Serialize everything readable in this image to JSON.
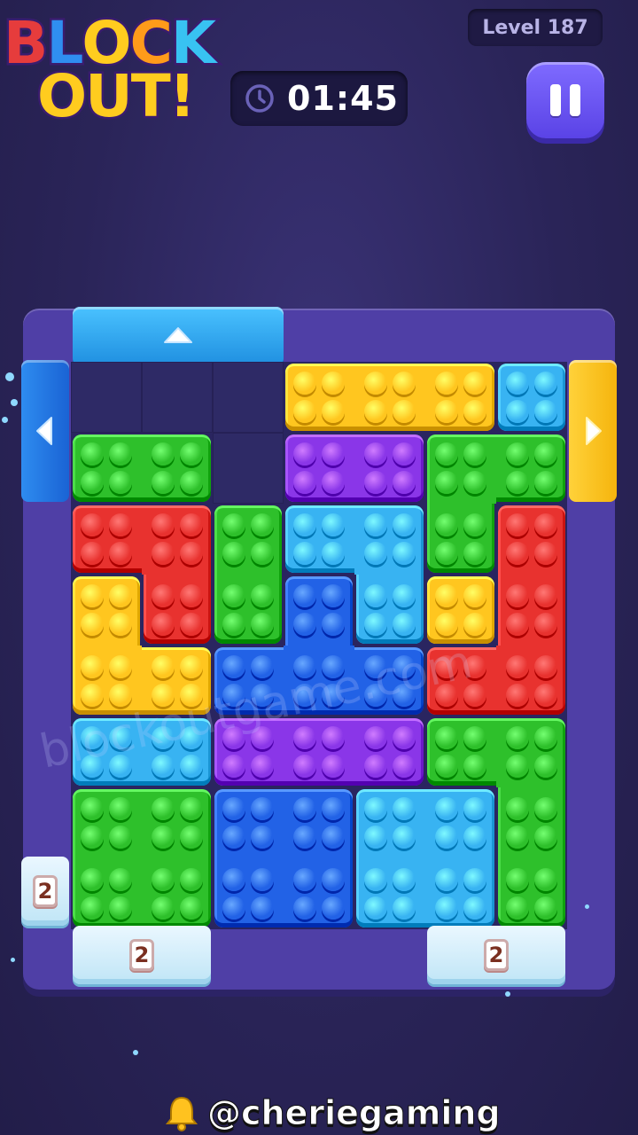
{
  "logo": {
    "line1": "BLOCK",
    "line2": "OUT!",
    "line1_colors": [
      "#e63c3c",
      "#2f8ef0",
      "#ffcc1f",
      "#ff9b1a",
      "#38c2f2"
    ],
    "line2_colors": [
      "#ffcc1f",
      "#ffcc1f",
      "#ffcc1f",
      "#ffcc1f"
    ]
  },
  "header": {
    "level": "Level 187",
    "timer": "01:45"
  },
  "colors": {
    "yellow": "#ffc61f",
    "red": "#e8322f",
    "green": "#2ec02b",
    "purple": "#8a36e8",
    "cyan": "#38b3f2",
    "blue": "#2262e6"
  },
  "grid": {
    "cols": 7,
    "rows": 8
  },
  "blocks": [
    {
      "color": "yellow",
      "cells": [
        [
          3,
          0
        ],
        [
          4,
          0
        ],
        [
          5,
          0
        ]
      ]
    },
    {
      "color": "cyan",
      "cells": [
        [
          6,
          0
        ]
      ]
    },
    {
      "color": "green",
      "cells": [
        [
          0,
          1
        ],
        [
          1,
          1
        ]
      ]
    },
    {
      "color": "purple",
      "cells": [
        [
          3,
          1
        ],
        [
          4,
          1
        ]
      ]
    },
    {
      "color": "green",
      "cells": [
        [
          5,
          1
        ],
        [
          6,
          1
        ],
        [
          5,
          2
        ]
      ]
    },
    {
      "color": "red",
      "cells": [
        [
          0,
          2
        ],
        [
          1,
          2
        ],
        [
          1,
          3
        ]
      ]
    },
    {
      "color": "green",
      "cells": [
        [
          2,
          2
        ],
        [
          2,
          3
        ]
      ]
    },
    {
      "color": "cyan",
      "cells": [
        [
          3,
          2
        ],
        [
          4,
          2
        ],
        [
          4,
          3
        ]
      ]
    },
    {
      "color": "red",
      "cells": [
        [
          6,
          2
        ],
        [
          6,
          3
        ],
        [
          5,
          4
        ],
        [
          6,
          4
        ]
      ]
    },
    {
      "color": "yellow",
      "cells": [
        [
          0,
          3
        ],
        [
          0,
          4
        ],
        [
          1,
          4
        ]
      ]
    },
    {
      "color": "blue",
      "cells": [
        [
          3,
          3
        ],
        [
          2,
          4
        ],
        [
          3,
          4
        ],
        [
          4,
          4
        ]
      ]
    },
    {
      "color": "yellow",
      "cells": [
        [
          5,
          3
        ]
      ]
    },
    {
      "color": "cyan",
      "cells": [
        [
          0,
          5
        ],
        [
          1,
          5
        ]
      ]
    },
    {
      "color": "purple",
      "cells": [
        [
          2,
          5
        ],
        [
          3,
          5
        ],
        [
          4,
          5
        ]
      ]
    },
    {
      "color": "green",
      "cells": [
        [
          5,
          5
        ],
        [
          6,
          5
        ],
        [
          6,
          6
        ],
        [
          6,
          7
        ]
      ]
    },
    {
      "color": "green",
      "cells": [
        [
          0,
          6
        ],
        [
          1,
          6
        ],
        [
          0,
          7
        ],
        [
          1,
          7
        ]
      ]
    },
    {
      "color": "blue",
      "cells": [
        [
          2,
          6
        ],
        [
          3,
          6
        ],
        [
          2,
          7
        ],
        [
          3,
          7
        ]
      ]
    },
    {
      "color": "cyan",
      "cells": [
        [
          4,
          6
        ],
        [
          5,
          6
        ],
        [
          4,
          7
        ],
        [
          5,
          7
        ]
      ]
    }
  ],
  "empty_cells": [
    [
      0,
      0
    ],
    [
      1,
      0
    ],
    [
      2,
      0
    ],
    [
      2,
      1
    ]
  ],
  "exits": {
    "top": {
      "color": "cyan",
      "arrow": "up-arrow-icon"
    },
    "left": {
      "color": "blue",
      "arrow": "left-arrow-icon"
    },
    "right": {
      "color": "yellow",
      "arrow": "right-arrow-icon"
    }
  },
  "ice_counters": {
    "left": "2",
    "bottom_left": "2",
    "bottom_right": "2"
  },
  "watermark": "blockoutgame.com",
  "footer": {
    "handle": "@cheriegaming",
    "icon": "bell-icon"
  }
}
